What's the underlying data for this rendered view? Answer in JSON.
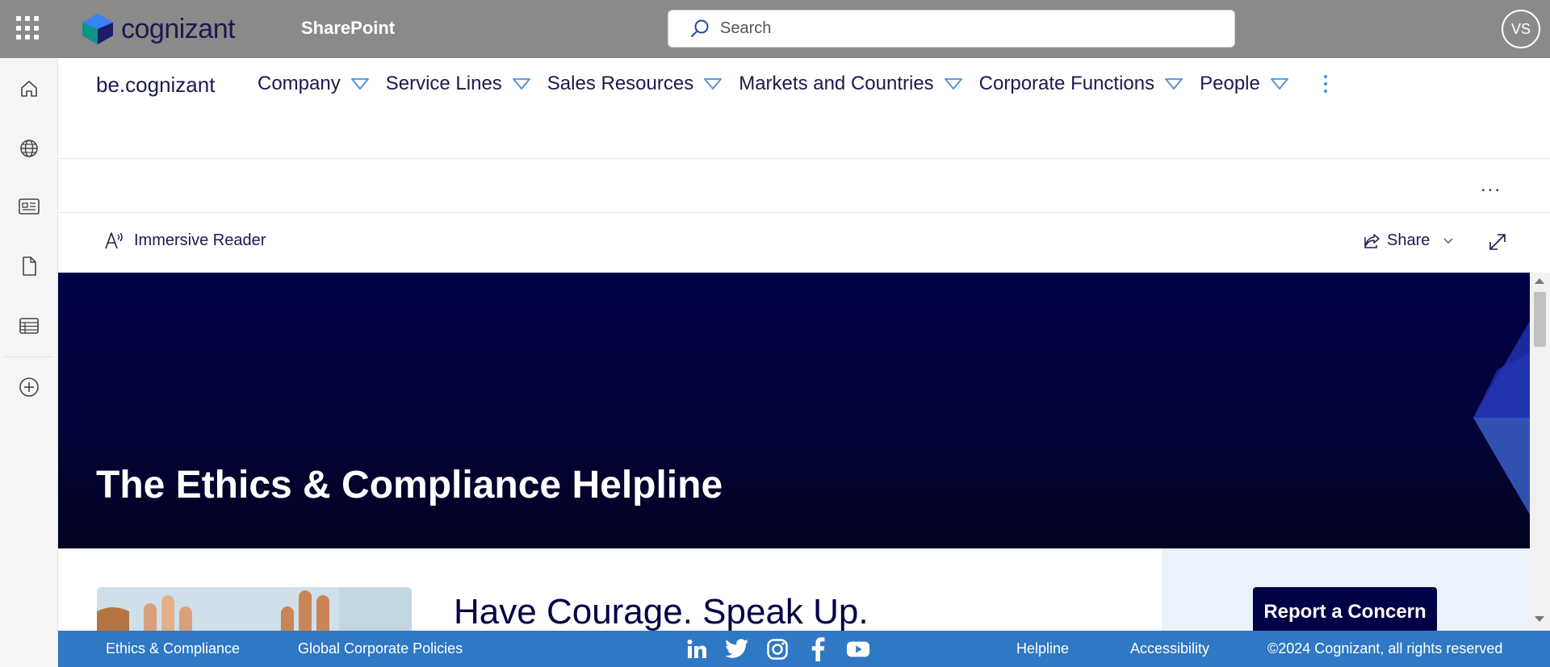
{
  "suitebar": {
    "brand": "cognizant",
    "app_name": "SharePoint",
    "search_placeholder": "Search",
    "user_initials": "VS",
    "color": "#8a8a8a"
  },
  "rail": {
    "items": [
      {
        "name": "home-icon"
      },
      {
        "name": "globe-icon"
      },
      {
        "name": "news-icon"
      },
      {
        "name": "file-icon"
      },
      {
        "name": "list-icon"
      },
      {
        "name": "add-icon"
      }
    ]
  },
  "hubnav": {
    "title": "be.cognizant",
    "items": [
      {
        "label": "Company"
      },
      {
        "label": "Service Lines"
      },
      {
        "label": "Sales Resources"
      },
      {
        "label": "Markets and Countries"
      },
      {
        "label": "Corporate Functions"
      },
      {
        "label": "People"
      }
    ]
  },
  "commandbar": {
    "more": "..."
  },
  "pagebar": {
    "immersive_reader": "Immersive Reader",
    "share": "Share"
  },
  "hero": {
    "title": "The Ethics & Compliance Helpline",
    "bg_color": "#000046"
  },
  "content": {
    "headline": "Have Courage. Speak Up.",
    "report_button": "Report a Concern"
  },
  "footer": {
    "links": [
      "Ethics & Compliance",
      "Global Corporate Policies",
      "Helpline",
      "Accessibility"
    ],
    "social": [
      "linkedin-icon",
      "twitter-icon",
      "instagram-icon",
      "facebook-icon",
      "youtube-icon"
    ],
    "copyright": "©2024 Cognizant, all rights reserved",
    "color": "#2f78c4"
  }
}
